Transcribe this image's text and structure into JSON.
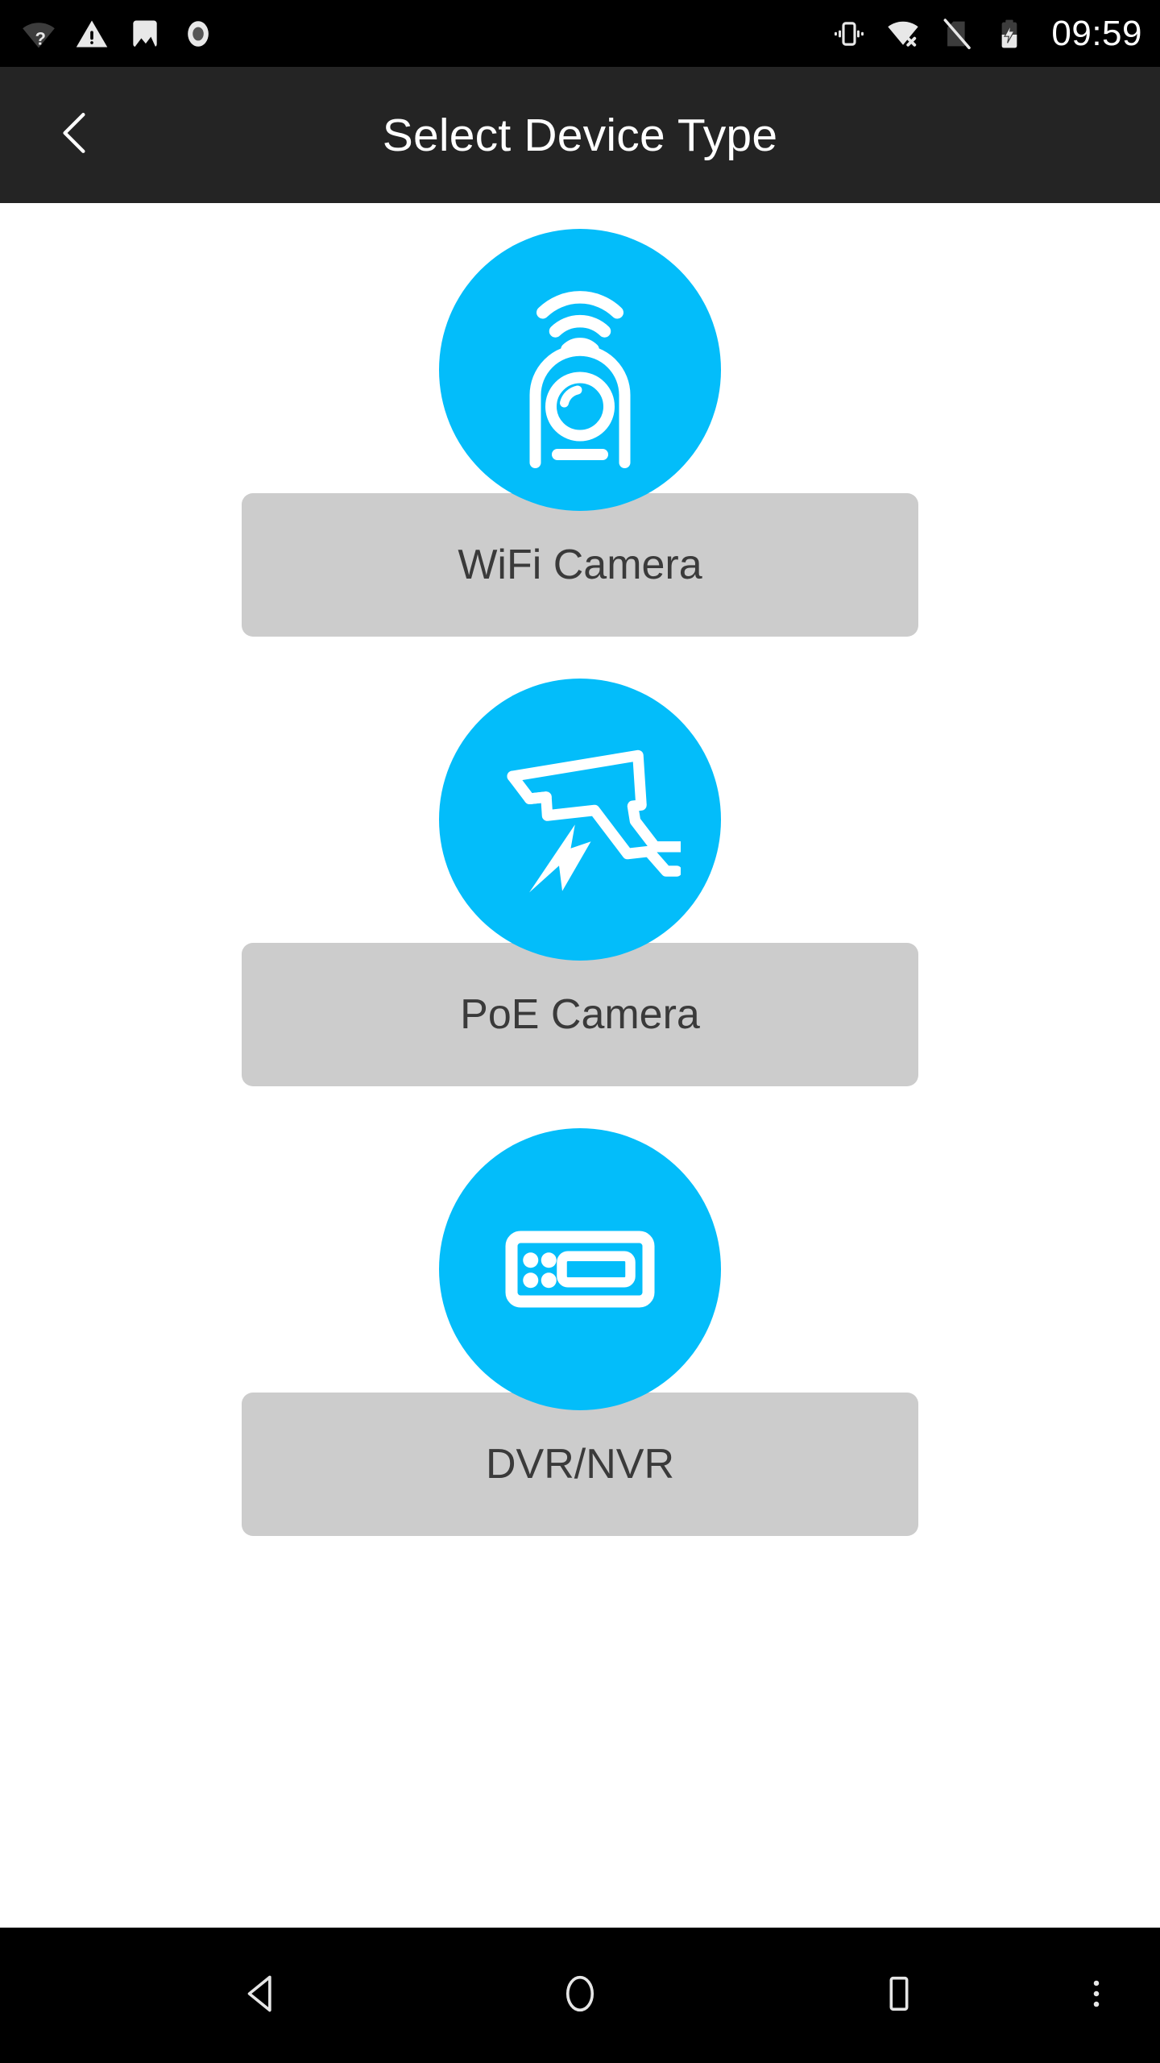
{
  "status_bar": {
    "background": "#000000",
    "time": "09:59",
    "left_icons": [
      {
        "name": "wifi-help-icon",
        "label": "WiFi unknown",
        "color": "#3c3c3c"
      },
      {
        "name": "warning-icon",
        "label": "Warning",
        "color": "#e8e8e8"
      },
      {
        "name": "image-icon",
        "label": "Image",
        "color": "#e8e8e8"
      },
      {
        "name": "record-icon",
        "label": "Screen record",
        "color": "#e8e8e8"
      }
    ],
    "right_icons": [
      {
        "name": "vibrate-icon",
        "label": "Vibrate mode",
        "color": "#e8e8e8"
      },
      {
        "name": "wifi-off-icon",
        "label": "WiFi no network",
        "color": "#e8e8e8"
      },
      {
        "name": "no-sim-icon",
        "label": "No SIM card",
        "color": "#3c3c3c"
      },
      {
        "name": "battery-charging-icon",
        "label": "Battery charging",
        "color": "#e8e8e8"
      }
    ]
  },
  "app_bar": {
    "background": "#242424",
    "title": "Select Device Type",
    "back_label": "Back",
    "back_icon": "chevron-left-icon",
    "title_color": "#ffffff"
  },
  "content": {
    "background": "#ffffff",
    "accent_color": "#03BDFA",
    "button_color": "#cccccc",
    "button_text_color": "#3a3a3a",
    "devices": [
      {
        "id": "wifi-camera",
        "label": "WiFi Camera",
        "icon": "wifi-camera-icon"
      },
      {
        "id": "poe-camera",
        "label": "PoE Camera",
        "icon": "poe-camera-icon"
      },
      {
        "id": "dvr-nvr",
        "label": "DVR/NVR",
        "icon": "dvr-nvr-icon"
      }
    ]
  },
  "nav_bar": {
    "background": "#000000",
    "buttons": [
      {
        "name": "nav-back-button",
        "label": "Back",
        "icon": "triangle-left-icon"
      },
      {
        "name": "nav-home-button",
        "label": "Home",
        "icon": "circle-icon"
      },
      {
        "name": "nav-recents-button",
        "label": "Recents",
        "icon": "square-icon"
      },
      {
        "name": "nav-overflow-button",
        "label": "More",
        "icon": "dots-vertical-icon"
      }
    ]
  }
}
